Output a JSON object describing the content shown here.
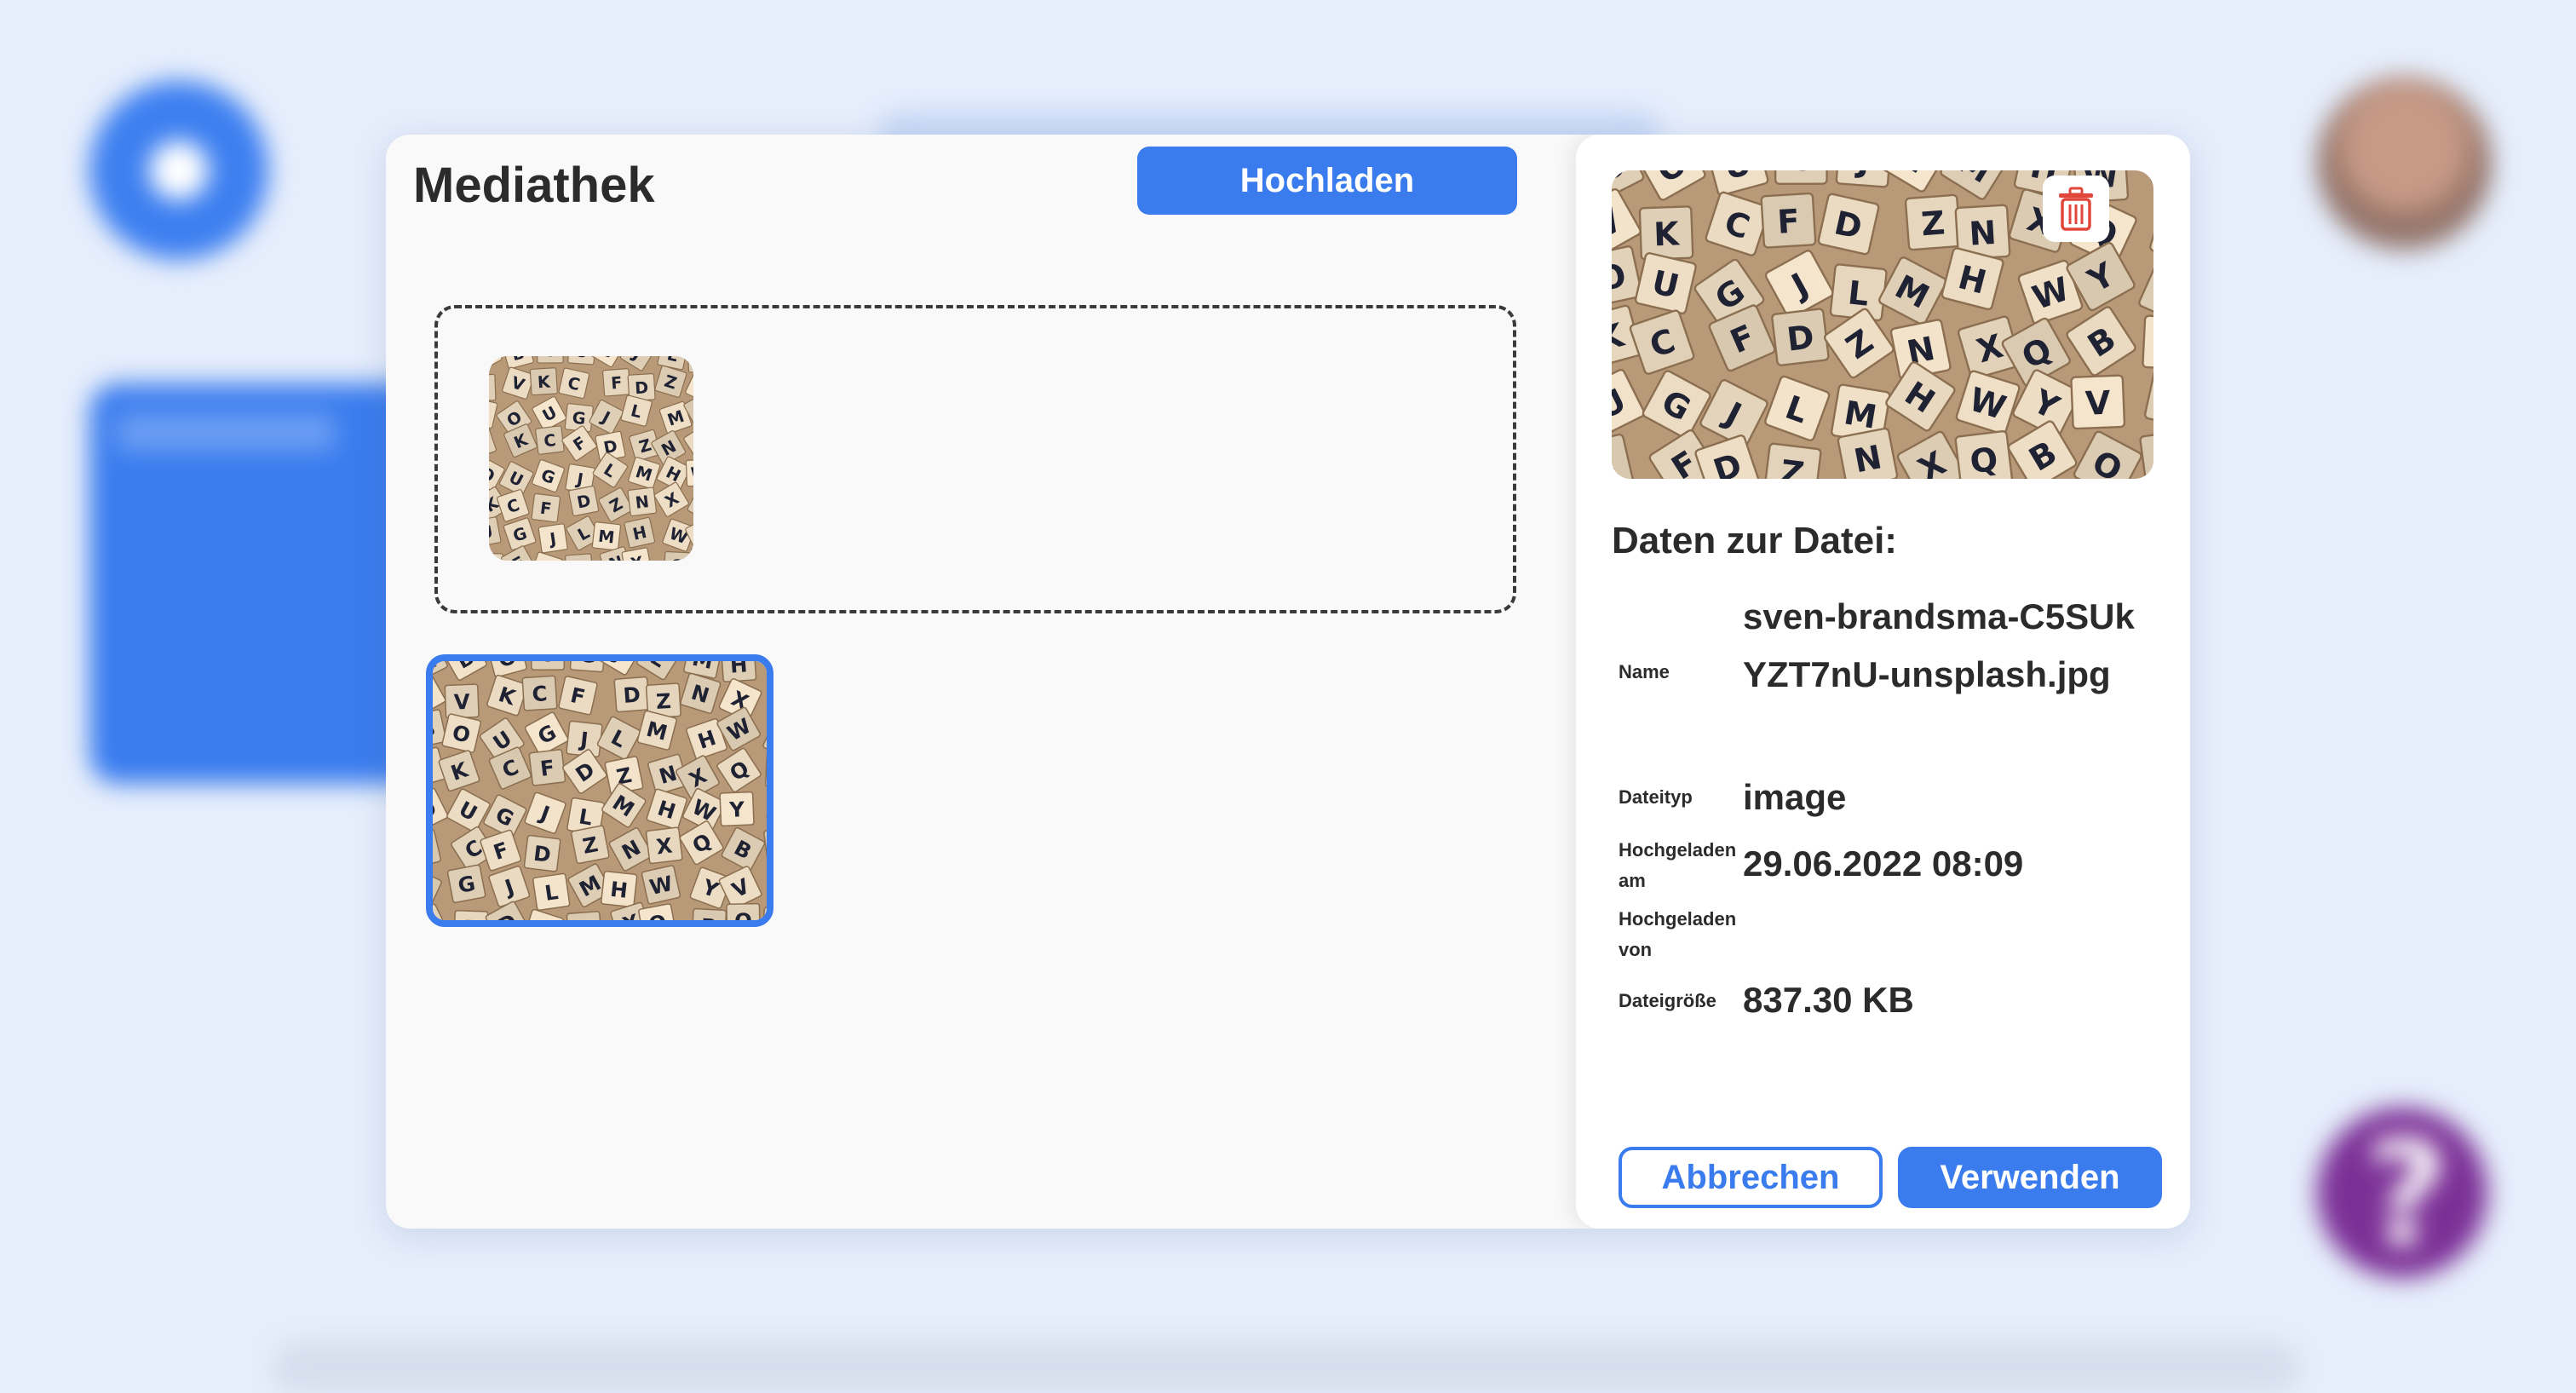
{
  "modal": {
    "title": "Mediathek",
    "upload_label": "Hochladen"
  },
  "details": {
    "heading": "Daten zur Datei:",
    "fields": [
      {
        "label": "Name",
        "value": "sven-brandsma-C5SUkYZT7nU-unsplash.jpg"
      },
      {
        "label": "Dateityp",
        "value": "image"
      },
      {
        "label": "Hochgeladen am",
        "value": "29.06.2022 08:09"
      },
      {
        "label": "Hochgeladen von",
        "value": ""
      },
      {
        "label": "Dateigröße",
        "value": "837.30 KB"
      }
    ],
    "cancel_label": "Abbrechen",
    "use_label": "Verwenden"
  },
  "media": {
    "thumbnail_subject": "wooden letter tiles photo",
    "tile_letters": [
      "X",
      "Q",
      "B",
      "O",
      "U",
      "G",
      "J",
      "L",
      "M",
      "H",
      "W",
      "Y",
      "V",
      "K",
      "C",
      "F",
      "D",
      "Z",
      "N"
    ]
  },
  "icons": {
    "delete": "trash-icon",
    "background_back": "back-arrow-icon",
    "background_help": "help-icon"
  },
  "colors": {
    "accent": "#3a7cee",
    "delete": "#e0463a",
    "help_bg": "#7b2f96"
  }
}
